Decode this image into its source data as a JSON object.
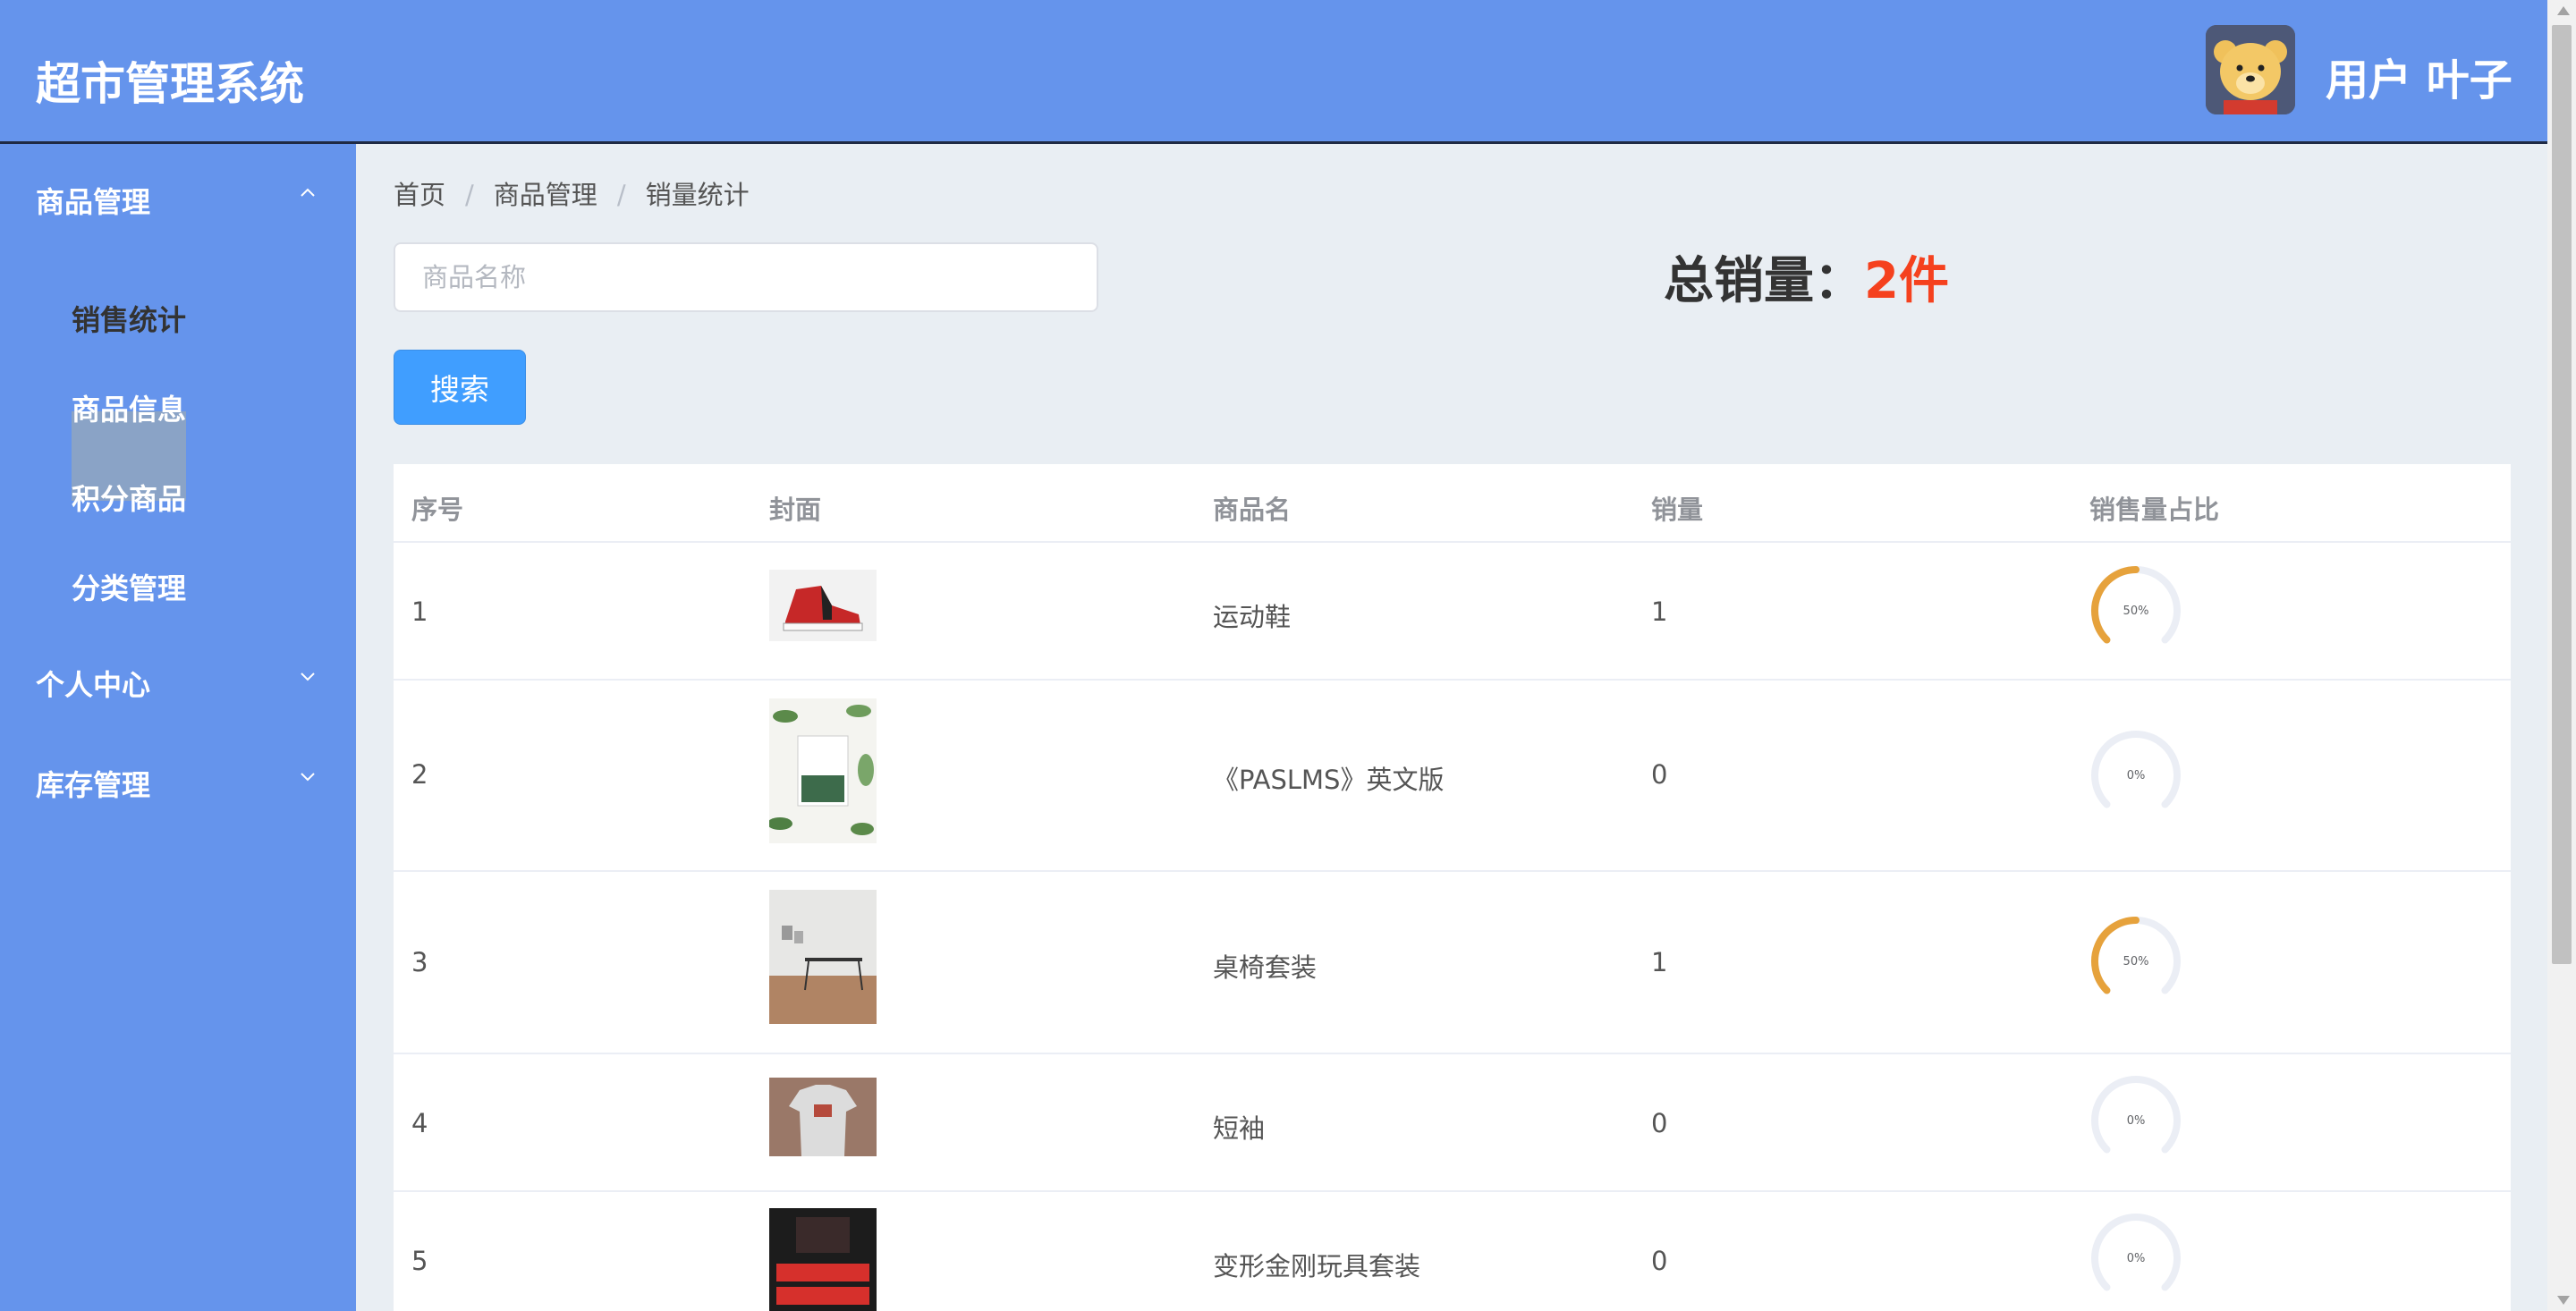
{
  "app": {
    "title": "超市管理系统"
  },
  "header": {
    "user_label": "用户 叶子"
  },
  "sidebar": {
    "groups": [
      {
        "label": "商品管理",
        "expanded": true,
        "items": [
          "销售统计",
          "商品信息",
          "积分商品",
          "分类管理"
        ]
      },
      {
        "label": "个人中心",
        "expanded": false
      },
      {
        "label": "库存管理",
        "expanded": false
      }
    ],
    "active_item": "销售统计"
  },
  "breadcrumb": [
    "首页",
    "商品管理",
    "销量统计"
  ],
  "search": {
    "placeholder": "商品名称",
    "button_label": "搜索"
  },
  "summary": {
    "label": "总销量：",
    "value": "2件"
  },
  "table": {
    "headers": [
      "序号",
      "封面",
      "商品名",
      "销量",
      "销售量占比"
    ],
    "rows": [
      {
        "index": "1",
        "name": "运动鞋",
        "sales": "1",
        "ratio_label": "50%",
        "ratio": 0.5
      },
      {
        "index": "2",
        "name": "《PASLMS》英文版",
        "sales": "0",
        "ratio_label": "0%",
        "ratio": 0
      },
      {
        "index": "3",
        "name": "桌椅套装",
        "sales": "1",
        "ratio_label": "50%",
        "ratio": 0.5
      },
      {
        "index": "4",
        "name": "短袖",
        "sales": "0",
        "ratio_label": "0%",
        "ratio": 0
      },
      {
        "index": "5",
        "name": "变形金刚玩具套装",
        "sales": "0",
        "ratio_label": "0%",
        "ratio": 0
      }
    ]
  },
  "colors": {
    "header_bg": "#6594ec",
    "accent": "#409eff",
    "total": "#f5411e",
    "ring": "#e6a23c"
  }
}
